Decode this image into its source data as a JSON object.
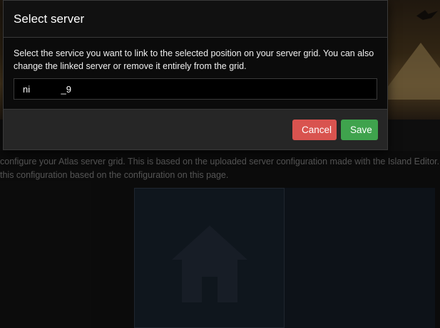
{
  "modal": {
    "title": "Select server",
    "description": "Select the service you want to link to the selected position on your server grid. You can also change the linked server or remove it entirely from the grid.",
    "input_value": "ni            _9",
    "cancel_label": "Cancel",
    "save_label": "Save"
  },
  "page": {
    "line1": "configure your Atlas server grid. This is based on the uploaded server configuration made with the Island Editor.",
    "line2": "this configuration based on the configuration on this page."
  },
  "icons": {
    "grid_cell": "home-icon"
  },
  "colors": {
    "cancel": "#d9534f",
    "save": "#3fa34d"
  }
}
